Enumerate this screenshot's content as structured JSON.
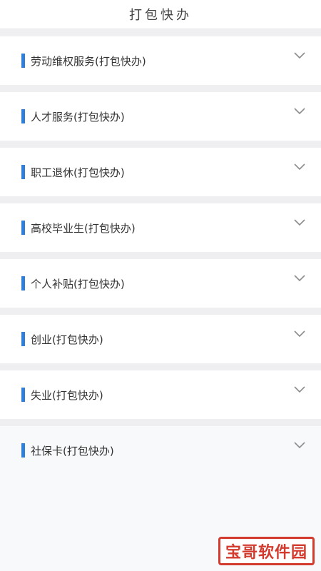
{
  "header": {
    "title": "打包快办"
  },
  "sections": [
    {
      "label": "劳动维权服务(打包快办)"
    },
    {
      "label": "人才服务(打包快办)"
    },
    {
      "label": "职工退休(打包快办)"
    },
    {
      "label": "高校毕业生(打包快办)"
    },
    {
      "label": "个人补贴(打包快办)"
    },
    {
      "label": "创业(打包快办)"
    },
    {
      "label": "失业(打包快办)"
    },
    {
      "label": "社保卡(打包快办)"
    }
  ],
  "icons": {
    "expand": "chevron-down-icon"
  },
  "colors": {
    "accent": "#2f7fd9",
    "watermark": "#d33b2f"
  },
  "watermark": {
    "text": "宝哥软件园"
  }
}
